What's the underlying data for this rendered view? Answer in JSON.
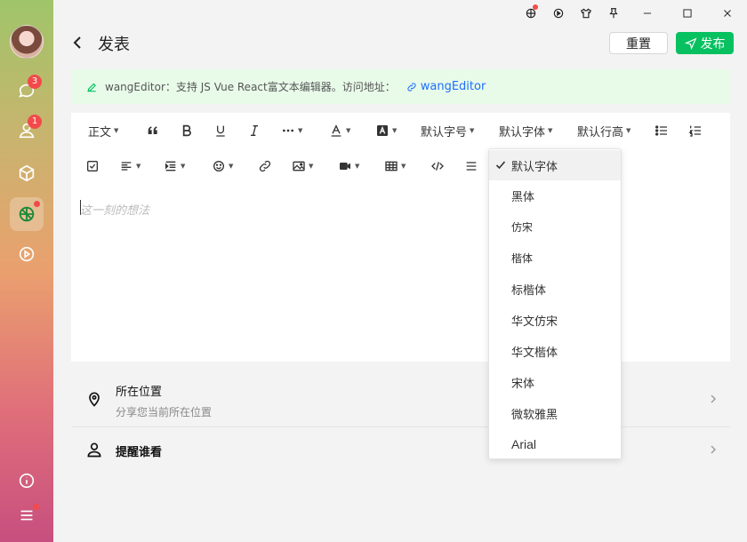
{
  "header": {
    "title": "发表",
    "reset_label": "重置",
    "publish_label": "发布"
  },
  "sidebar": {
    "chat_badge": "3",
    "contacts_badge": "1",
    "items": [
      {
        "name": "avatar"
      },
      {
        "name": "chat-icon"
      },
      {
        "name": "contacts-icon"
      },
      {
        "name": "cube-icon"
      },
      {
        "name": "moments-icon"
      },
      {
        "name": "video-icon"
      },
      {
        "name": "info-icon"
      },
      {
        "name": "menu-icon"
      }
    ]
  },
  "notice": {
    "text": "wangEditor：支持 JS Vue React富文本编辑器。访问地址：",
    "link": "wangEditor"
  },
  "toolbar": {
    "paragraph": "正文",
    "font_size": "默认字号",
    "font_family": "默认字体",
    "line_height": "默认行高"
  },
  "editor": {
    "placeholder": "这一刻的想法"
  },
  "location": {
    "title": "所在位置",
    "subtitle": "分享您当前所在位置"
  },
  "remind": {
    "title": "提醒谁看"
  },
  "font_dropdown": {
    "selected": "默认字体",
    "options": [
      "默认字体",
      "黑体",
      "仿宋",
      "楷体",
      "标楷体",
      "华文仿宋",
      "华文楷体",
      "宋体",
      "微软雅黑",
      "Arial"
    ]
  },
  "colors": {
    "accent": "#07c160",
    "link": "#1e6fff",
    "badge": "#f24a4a"
  }
}
